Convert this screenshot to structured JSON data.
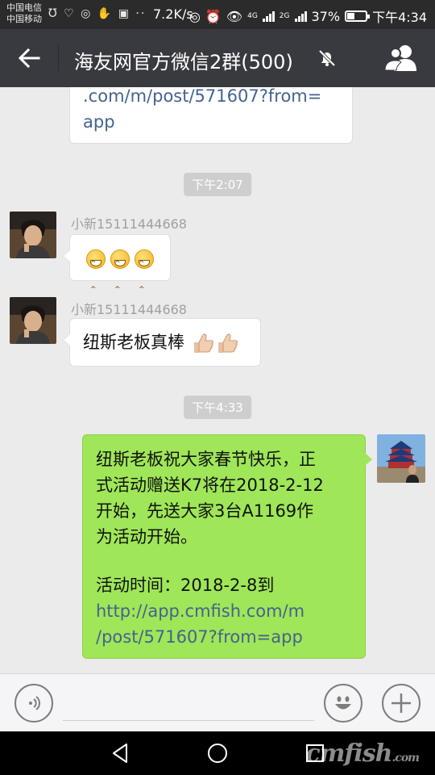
{
  "status_bar": {
    "carrier_1": "中国电信",
    "carrier_2": "中国移动",
    "speed": "7.2K/s",
    "network_1": "4G",
    "network_2": "2G",
    "battery": "37%",
    "battery_level": 0.37,
    "time": "下午4:34"
  },
  "header": {
    "title": "海友网官方微信2群(500)"
  },
  "messages": {
    "partial_link": {
      "line1": ".com/m/post/571607?from=",
      "line2": "app"
    },
    "time_1": "下午2:07",
    "msg_1": {
      "sender": "小新15111444668"
    },
    "msg_2": {
      "sender": "小新15111444668",
      "text": "纽斯老板真棒"
    },
    "time_2": "下午4:33",
    "msg_3": {
      "line1": "纽斯老板祝大家春节快乐，正",
      "line2": "式活动赠送K7将在2018-2-12",
      "line3": "开始，先送大家3台A1169作",
      "line4": "为活动开始。",
      "line5": "活动时间：2018-2-8到",
      "link1": "http://app.cmfish.com/m",
      "link2": "/post/571607?from=app"
    }
  },
  "input": {
    "placeholder": ""
  },
  "watermark": {
    "main": "cmfish",
    "suffix": ".com"
  }
}
